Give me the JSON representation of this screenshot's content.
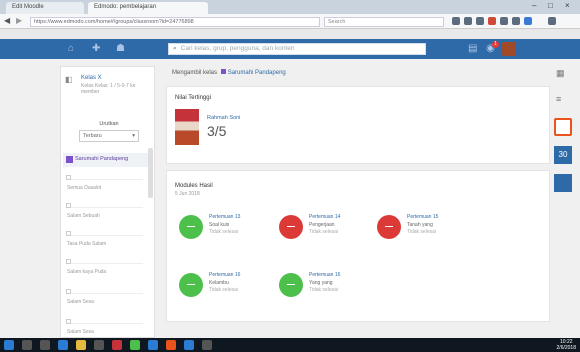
{
  "browser": {
    "tabs": [
      {
        "label": "Edit Moodle"
      },
      {
        "label": "Edmodo: pembelajaran"
      }
    ],
    "url": "https://www.edmodo.com/home#/groups/classroom?id=24776898",
    "search_placeholder": "Search",
    "window_controls": [
      "–",
      "□",
      "×"
    ]
  },
  "app_header": {
    "search_placeholder": "Cari kelas, grup, pengguna, dan konten",
    "notification_count": "1"
  },
  "left_panel": {
    "title": "Kelas X",
    "subtitle": "Kelas Kelas: 1 / 5-0-7 ke member",
    "sort_label": "Urutkan",
    "sort_value": "Terbaru",
    "section_label": "Sarumahi Pandapeng",
    "items": [
      "Semua Dasalot",
      "Salam Sebuah",
      "Tasa Puda Salam",
      "Salam kaya Puda",
      "Salam Sesa",
      "Salam Sesa"
    ]
  },
  "main": {
    "breadcrumb_prefix": "Mengambil kelas",
    "breadcrumb_current": "Sarumahi Pandapeng",
    "student_card": {
      "heading": "Nilai Tertinggi",
      "name": "Rahmah Soni",
      "score": "3/5"
    },
    "modules_card": {
      "heading": "Modules Hasil",
      "subheading": "5 Jun 2018",
      "modules": [
        {
          "title": "Pertemuan 13",
          "subtitle": "Soal kuis",
          "status": "Tidak selesai",
          "color": "#4cc04a"
        },
        {
          "title": "Pertemuan 14",
          "subtitle": "Pengerjaan",
          "status": "Tidak selesai",
          "color": "#dc3a37"
        },
        {
          "title": "Pertemuan 15",
          "subtitle": "Tanah yang",
          "status": "Tidak selesai",
          "color": "#dc3a37"
        },
        {
          "title": "Pertemuan 16",
          "subtitle": "Kelambu",
          "status": "Tidak selesai",
          "color": "#4cc04a"
        },
        {
          "title": "Pertemuan 16",
          "subtitle": "Yang yang",
          "status": "Tidak selesai",
          "color": "#4cc04a"
        }
      ]
    }
  },
  "rail": {
    "calendar_day": "30"
  },
  "taskbar": {
    "time": "10:22",
    "date": "2/6/2018"
  },
  "colors": {
    "header_blue": "#2f6aa8",
    "accent_purple": "#7b52c9",
    "status_green": "#4cc04a",
    "status_red": "#dc3a37"
  }
}
